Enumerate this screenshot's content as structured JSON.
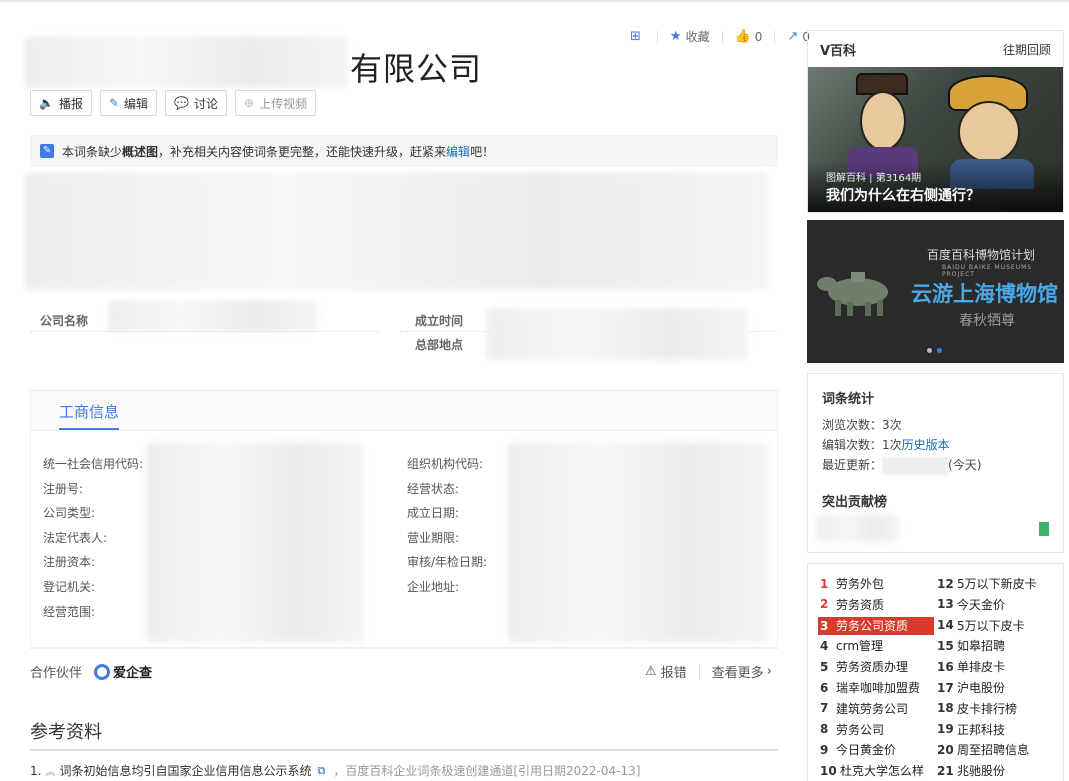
{
  "title_suffix": "有限公司",
  "actions": {
    "collect": "收藏",
    "like_count": "0",
    "share_count": "0"
  },
  "buttons": {
    "play": "播报",
    "edit": "编辑",
    "discuss": "讨论",
    "upload_video": "上传视频"
  },
  "notice": {
    "pre": "本词条缺少",
    "bold": "概述图",
    "mid": "，补充相关内容使词条更完整，还能快速升级，赶紧来",
    "link": "编辑",
    "post": "吧！"
  },
  "basic_info": {
    "company_name": "公司名称",
    "founded": "成立时间",
    "hq": "总部地点"
  },
  "biz_info": {
    "tab": "工商信息",
    "left_labels": [
      "统一社会信用代码:",
      "注册号:",
      "公司类型:",
      "法定代表人:",
      "注册资本:",
      "登记机关:",
      "经营范围:"
    ],
    "right_labels": [
      "组织机构代码:",
      "经营状态:",
      "成立日期:",
      "营业期限:",
      "审核/年检日期:",
      "企业地址:"
    ]
  },
  "partner": {
    "label": "合作伙伴",
    "name": "爱企查",
    "report": "报错",
    "more": "查看更多"
  },
  "references": {
    "title": "参考资料",
    "items": [
      {
        "num": "1.",
        "text": "词条初始信息均引自国家企业信用信息公示系统",
        "source": "，百度百科企业词条极速创建通道[引用日期2022-04-13]"
      }
    ]
  },
  "vbaike": {
    "title": "V百科",
    "more": "往期回顾",
    "caption_small": "图解百科 | 第3164期",
    "caption_big": "我们为什么在右侧通行？"
  },
  "museum": {
    "logo": "百度百科博物馆计划",
    "logo_sub": "BAIDU BAIKE MUSEUMS PROJECT",
    "title": "云游上海博物馆",
    "subtitle": "春秋牺尊"
  },
  "stats": {
    "title": "词条统计",
    "views_label": "浏览次数：",
    "views": "3次",
    "edits_label": "编辑次数：",
    "edits": "1次",
    "history": "历史版本",
    "updated_label": "最近更新：",
    "updated_suffix": "(今天)",
    "contrib_title": "突出贡献榜"
  },
  "hotlist": {
    "left": [
      {
        "n": "1",
        "t": "劳务外包"
      },
      {
        "n": "2",
        "t": "劳务资质"
      },
      {
        "n": "3",
        "t": "劳务公司资质"
      },
      {
        "n": "4",
        "t": "crm管理"
      },
      {
        "n": "5",
        "t": "劳务资质办理"
      },
      {
        "n": "6",
        "t": "瑞幸咖啡加盟费"
      },
      {
        "n": "7",
        "t": "建筑劳务公司"
      },
      {
        "n": "8",
        "t": "劳务公司"
      },
      {
        "n": "9",
        "t": "今日黄金价"
      },
      {
        "n": "10",
        "t": "杜克大学怎么样"
      }
    ],
    "right": [
      {
        "n": "12",
        "t": "5万以下新皮卡"
      },
      {
        "n": "13",
        "t": "今天金价"
      },
      {
        "n": "14",
        "t": "5万以下皮卡"
      },
      {
        "n": "15",
        "t": "如皋招聘"
      },
      {
        "n": "16",
        "t": "单排皮卡"
      },
      {
        "n": "17",
        "t": "沪电股份"
      },
      {
        "n": "18",
        "t": "皮卡排行榜"
      },
      {
        "n": "19",
        "t": "正邦科技"
      },
      {
        "n": "20",
        "t": "周至招聘信息"
      },
      {
        "n": "21",
        "t": "兆驰股份"
      }
    ]
  }
}
